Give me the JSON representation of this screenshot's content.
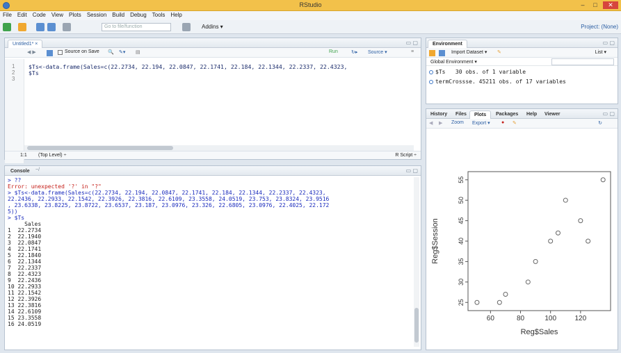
{
  "window": {
    "title": "RStudio",
    "min": "–",
    "max": "□",
    "close": "✕"
  },
  "menu": [
    "File",
    "Edit",
    "Code",
    "View",
    "Plots",
    "Session",
    "Build",
    "Debug",
    "Tools",
    "Help"
  ],
  "toolbar": {
    "goto_placeholder": "Go to file/function",
    "addins": "Addins ▾",
    "project": "Project: (None)"
  },
  "editor": {
    "tab": "Untitled1* ×",
    "source_on_save": "Source on Save",
    "run": "Run",
    "source": "Source ▾",
    "lines": [
      {
        "num": "1",
        "code": "$Ts<-data.frame(Sales=c(22.2734, 22.194, 22.0847, 22.1741, 22.184, 22.1344, 22.2337, 22.4323,"
      },
      {
        "num": "2",
        "code": "$Ts"
      },
      {
        "num": "3",
        "code": ""
      }
    ],
    "status_pos": "1:1",
    "status_scope": "(Top Level) ÷",
    "status_type": "R Script ÷"
  },
  "console": {
    "tab": "Console",
    "path": "~/",
    "lines": [
      {
        "type": "prompt",
        "text": "> ??"
      },
      {
        "type": "error",
        "text": "Error: unexpected '?' in \"?\""
      },
      {
        "type": "prompt",
        "text": "> $Ts<-data.frame(Sales=c(22.2734, 22.194, 22.0847, 22.1741, 22.184, 22.1344, 22.2337, 22.4323,"
      },
      {
        "type": "prompt",
        "text": "22.2436, 22.2933, 22.1542, 22.3926, 22.3816, 22.6109, 23.3558, 24.0519, 23.753, 23.8324, 23.9516"
      },
      {
        "type": "prompt",
        "text": ", 23.6338, 23.8225, 23.8722, 23.6537, 23.187, 23.0976, 23.326, 22.6805, 23.0976, 22.4025, 22.172"
      },
      {
        "type": "prompt",
        "text": "5))"
      },
      {
        "type": "prompt",
        "text": "> $Ts"
      },
      {
        "type": "out",
        "text": "     Sales"
      },
      {
        "type": "out",
        "text": "1  22.2734"
      },
      {
        "type": "out",
        "text": "2  22.1940"
      },
      {
        "type": "out",
        "text": "3  22.0847"
      },
      {
        "type": "out",
        "text": "4  22.1741"
      },
      {
        "type": "out",
        "text": "5  22.1840"
      },
      {
        "type": "out",
        "text": "6  22.1344"
      },
      {
        "type": "out",
        "text": "7  22.2337"
      },
      {
        "type": "out",
        "text": "8  22.4323"
      },
      {
        "type": "out",
        "text": "9  22.2436"
      },
      {
        "type": "out",
        "text": "10 22.2933"
      },
      {
        "type": "out",
        "text": "11 22.1542"
      },
      {
        "type": "out",
        "text": "12 22.3926"
      },
      {
        "type": "out",
        "text": "13 22.3816"
      },
      {
        "type": "out",
        "text": "14 22.6109"
      },
      {
        "type": "out",
        "text": "15 23.3558"
      },
      {
        "type": "out",
        "text": "16 24.0519"
      }
    ]
  },
  "environment": {
    "tab": "Environment",
    "import": "Import Dataset ▾",
    "list": "List ▾",
    "global": "Global Environment ▾",
    "rows": [
      {
        "name": "$Ts",
        "desc": "30 obs. of 1 variable"
      },
      {
        "name": "termCrossse.",
        "desc": "45211 obs. of 17 variables"
      }
    ]
  },
  "plots_pane": {
    "tabs": [
      "History",
      "Files",
      "Plots",
      "Packages",
      "Help",
      "Viewer"
    ],
    "zoom": "Zoom",
    "export": "Export ▾"
  },
  "chart_data": {
    "type": "scatter",
    "xlabel": "Reg$Sales",
    "ylabel": "Reg$Session",
    "xlim": [
      45,
      140
    ],
    "ylim": [
      23,
      57
    ],
    "x_ticks": [
      60,
      80,
      100,
      120
    ],
    "y_ticks": [
      25,
      30,
      35,
      40,
      45,
      50,
      55
    ],
    "points": [
      {
        "x": 51,
        "y": 25
      },
      {
        "x": 66,
        "y": 25
      },
      {
        "x": 70,
        "y": 27
      },
      {
        "x": 85,
        "y": 30
      },
      {
        "x": 90,
        "y": 35
      },
      {
        "x": 100,
        "y": 40
      },
      {
        "x": 105,
        "y": 42
      },
      {
        "x": 110,
        "y": 50
      },
      {
        "x": 120,
        "y": 45
      },
      {
        "x": 125,
        "y": 40
      },
      {
        "x": 135,
        "y": 55
      }
    ]
  }
}
